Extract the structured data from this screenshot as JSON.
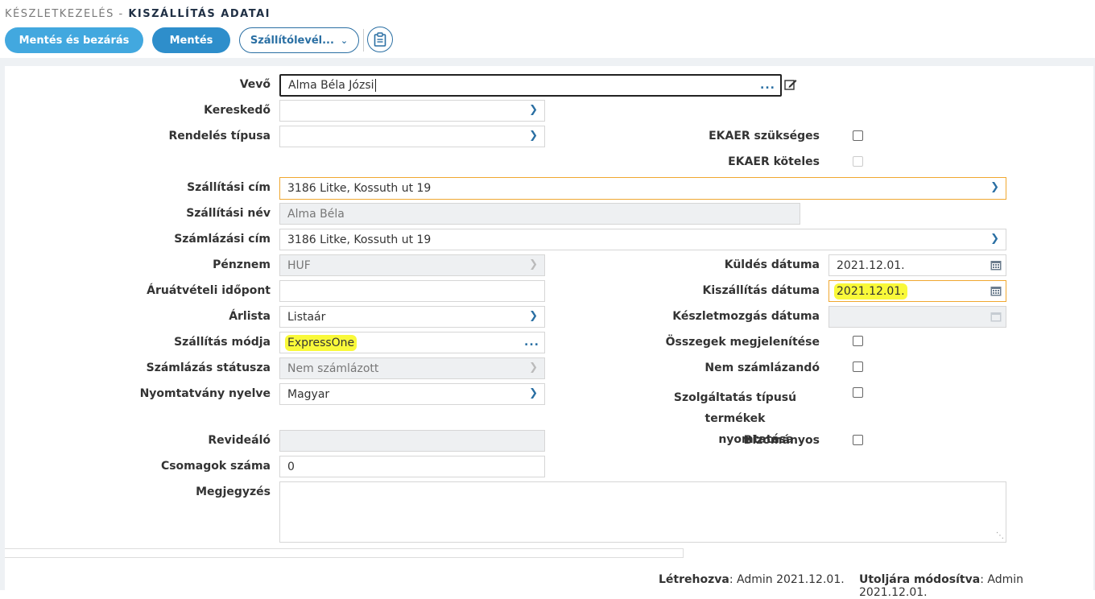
{
  "header": {
    "breadcrumb_root": "KÉSZLETKEZELÉS -",
    "page_title": "KISZÁLLÍTÁS ADATAI"
  },
  "toolbar": {
    "save_close": "Mentés és bezárás",
    "save": "Mentés",
    "delivery_note": "Szállítólevél..."
  },
  "form": {
    "vevo": {
      "label": "Vevő",
      "value": "Alma Béla Józsi"
    },
    "kereskedo": {
      "label": "Kereskedő",
      "value": ""
    },
    "rendeles_tipusa": {
      "label": "Rendelés típusa",
      "value": ""
    },
    "ekaer_szukseges": {
      "label": "EKAER szükséges",
      "checked": false
    },
    "ekaer_koteles": {
      "label": "EKAER köteles",
      "checked": false
    },
    "szallitasi_cim": {
      "label": "Szállítási cím",
      "value": "3186 Litke, Kossuth ut 19"
    },
    "szallitasi_nev": {
      "label": "Szállítási név",
      "value": "Alma Béla"
    },
    "szamlazasi_cim": {
      "label": "Számlázási cím",
      "value": "3186 Litke, Kossuth ut 19"
    },
    "penznem": {
      "label": "Pénznem",
      "value": "HUF"
    },
    "kuldes_datuma": {
      "label": "Küldés dátuma",
      "value": "2021.12.01."
    },
    "aruatveteli_idopont": {
      "label": "Áruátvételi időpont",
      "value": ""
    },
    "kiszallitas_datuma": {
      "label": "Kiszállítás dátuma",
      "value": "2021.12.01."
    },
    "arlista": {
      "label": "Árlista",
      "value": "Listaár"
    },
    "keszletmozgas_datuma": {
      "label": "Készletmozgás dátuma",
      "value": ""
    },
    "szallitas_modja": {
      "label": "Szállítás módja",
      "value": "ExpressOne"
    },
    "osszegek_megjelenitese": {
      "label": "Összegek megjelenítése",
      "checked": false
    },
    "szamlazas_statusza": {
      "label": "Számlázás státusza",
      "value": "Nem számlázott"
    },
    "nem_szamlazando": {
      "label": "Nem számlázandó",
      "checked": false
    },
    "nyomtatvany_nyelve": {
      "label": "Nyomtatvány nyelve",
      "value": "Magyar"
    },
    "szolgaltatas_line1": "Szolgáltatás típusú termékek",
    "szolgaltatas_line2": "nyomtatása",
    "revidealo": {
      "label": "Revideáló",
      "value": ""
    },
    "bizomanyos": {
      "label": "Bizományos",
      "checked": false
    },
    "csomagok_szama": {
      "label": "Csomagok száma",
      "value": "0"
    },
    "megjegyzes": {
      "label": "Megjegyzés",
      "value": ""
    }
  },
  "footer": {
    "created_label": "Létrehozva",
    "created_value": ": Admin 2021.12.01.",
    "modified_label": "Utoljára módosítva",
    "modified_value": ": Admin 2021.12.01."
  },
  "colors": {
    "primary": "#42a8df",
    "primary_dark": "#2e8ecb",
    "highlight": "#f9f93a",
    "focus_border": "#f0a830"
  }
}
